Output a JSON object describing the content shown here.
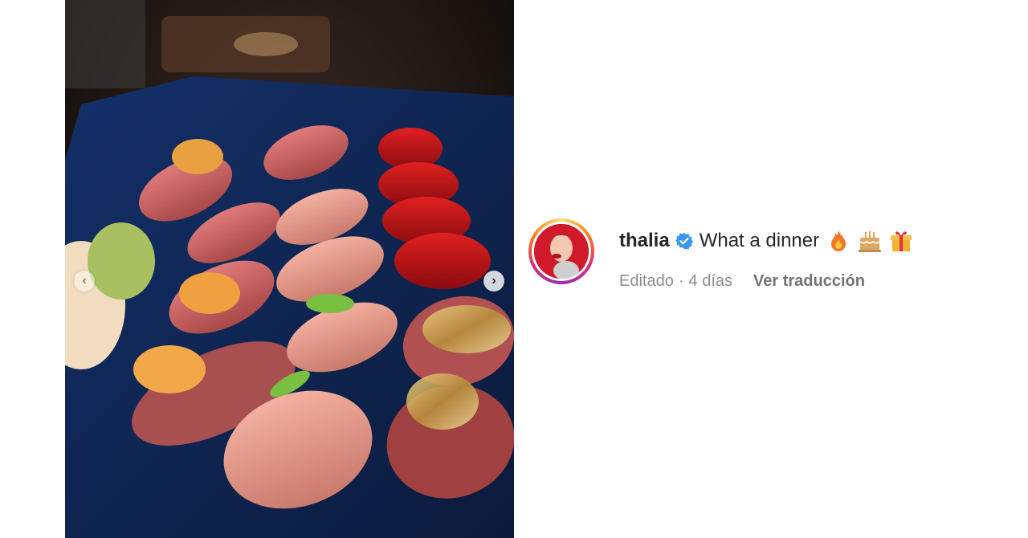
{
  "post": {
    "carousel": {
      "prev_glyph": "‹",
      "next_glyph": "›"
    },
    "caption": {
      "username": "thalia",
      "verified": true,
      "text": "What a dinner",
      "emojis": [
        "fire-emoji",
        "birthday-cake-emoji",
        "wrapped-gift-emoji"
      ]
    },
    "meta": {
      "edited": "Editado",
      "separator": "·",
      "time_ago": "4 días",
      "translate_label": "Ver traducción"
    },
    "colors": {
      "verified_badge": "#3897f0",
      "text_primary": "#262626",
      "text_secondary": "#8e8e8e",
      "story_ring": [
        "#feda75",
        "#fa7e1e",
        "#d62976",
        "#962fbf"
      ]
    },
    "icons": {
      "prev": "chevron-left-icon",
      "next": "chevron-right-icon",
      "verified": "verified-badge-icon"
    }
  }
}
